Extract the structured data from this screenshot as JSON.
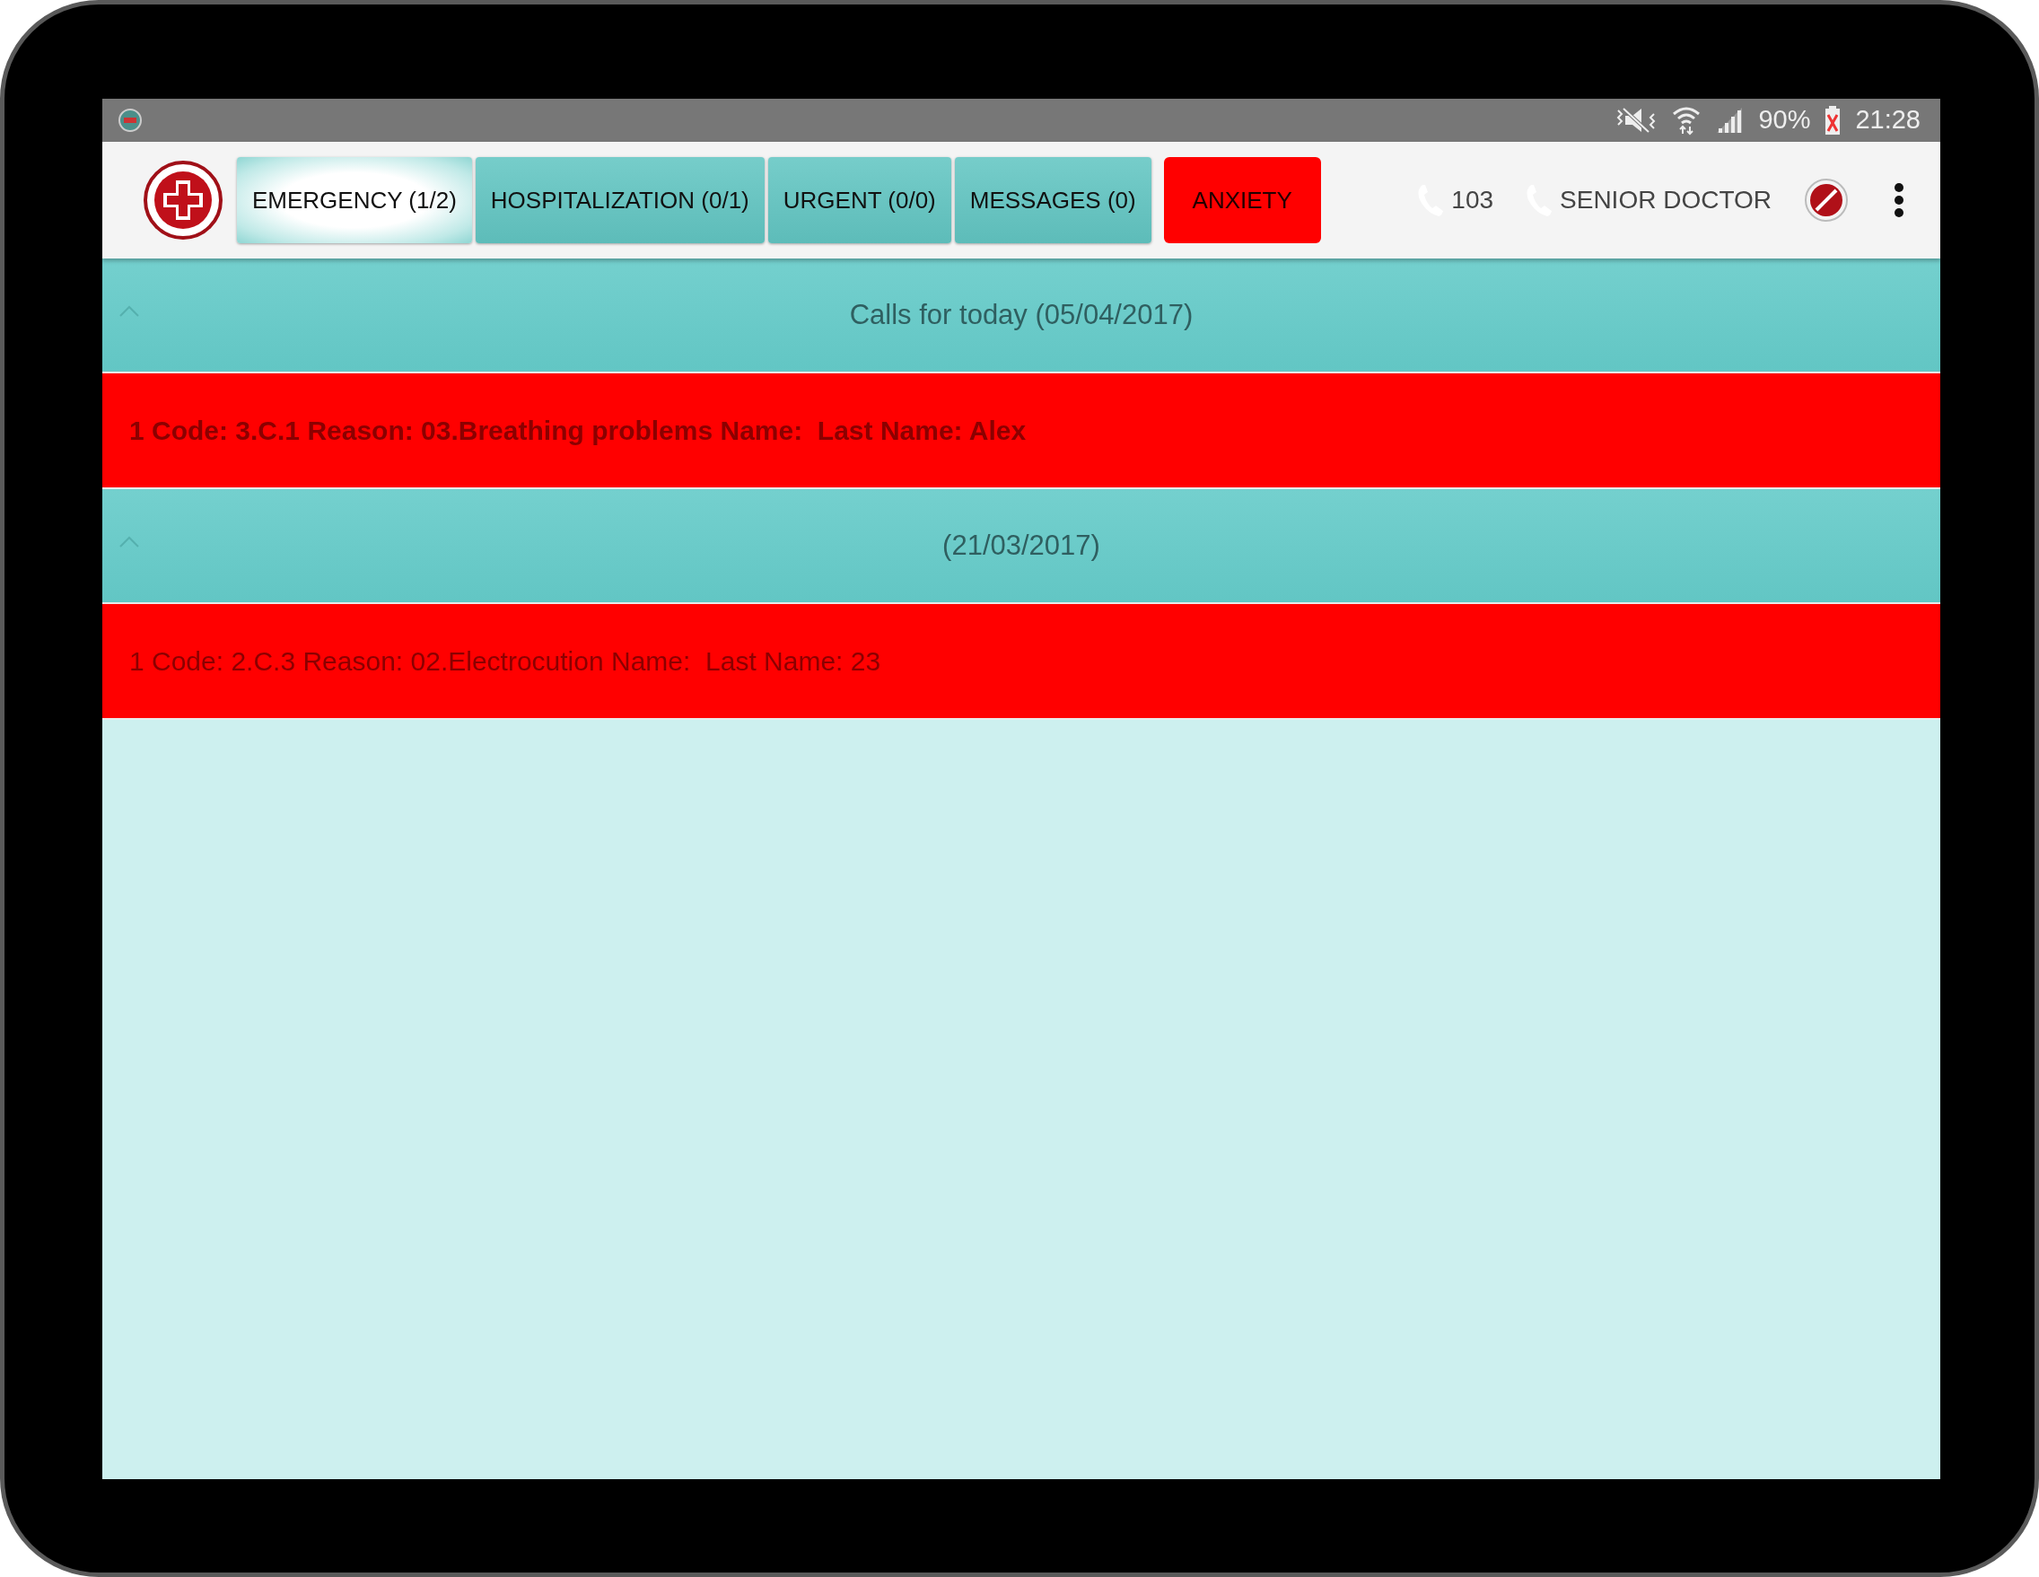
{
  "status_bar": {
    "battery": "90%",
    "time": "21:28"
  },
  "toolbar": {
    "tabs": [
      {
        "label": "EMERGENCY (1/2)",
        "selected": true
      },
      {
        "label": "HOSPITALIZATION (0/1)",
        "selected": false
      },
      {
        "label": "URGENT (0/0)",
        "selected": false
      },
      {
        "label": "MESSAGES (0)",
        "selected": false
      }
    ],
    "alert_button": "ANXIETY",
    "phones": [
      {
        "label": "103"
      },
      {
        "label": "SENIOR DOCTOR"
      }
    ]
  },
  "groups": [
    {
      "title": "Calls for today (05/04/2017)",
      "expanded": true,
      "calls": [
        {
          "text": "1 Code: 3.C.1 Reason: 03.Breathing problems Name:  Last Name: Alex",
          "unread": true
        }
      ]
    },
    {
      "title": "(21/03/2017)",
      "expanded": true,
      "calls": [
        {
          "text": "1 Code: 2.C.3 Reason: 02.Electrocution Name:  Last Name: 23",
          "unread": false
        }
      ]
    }
  ]
}
